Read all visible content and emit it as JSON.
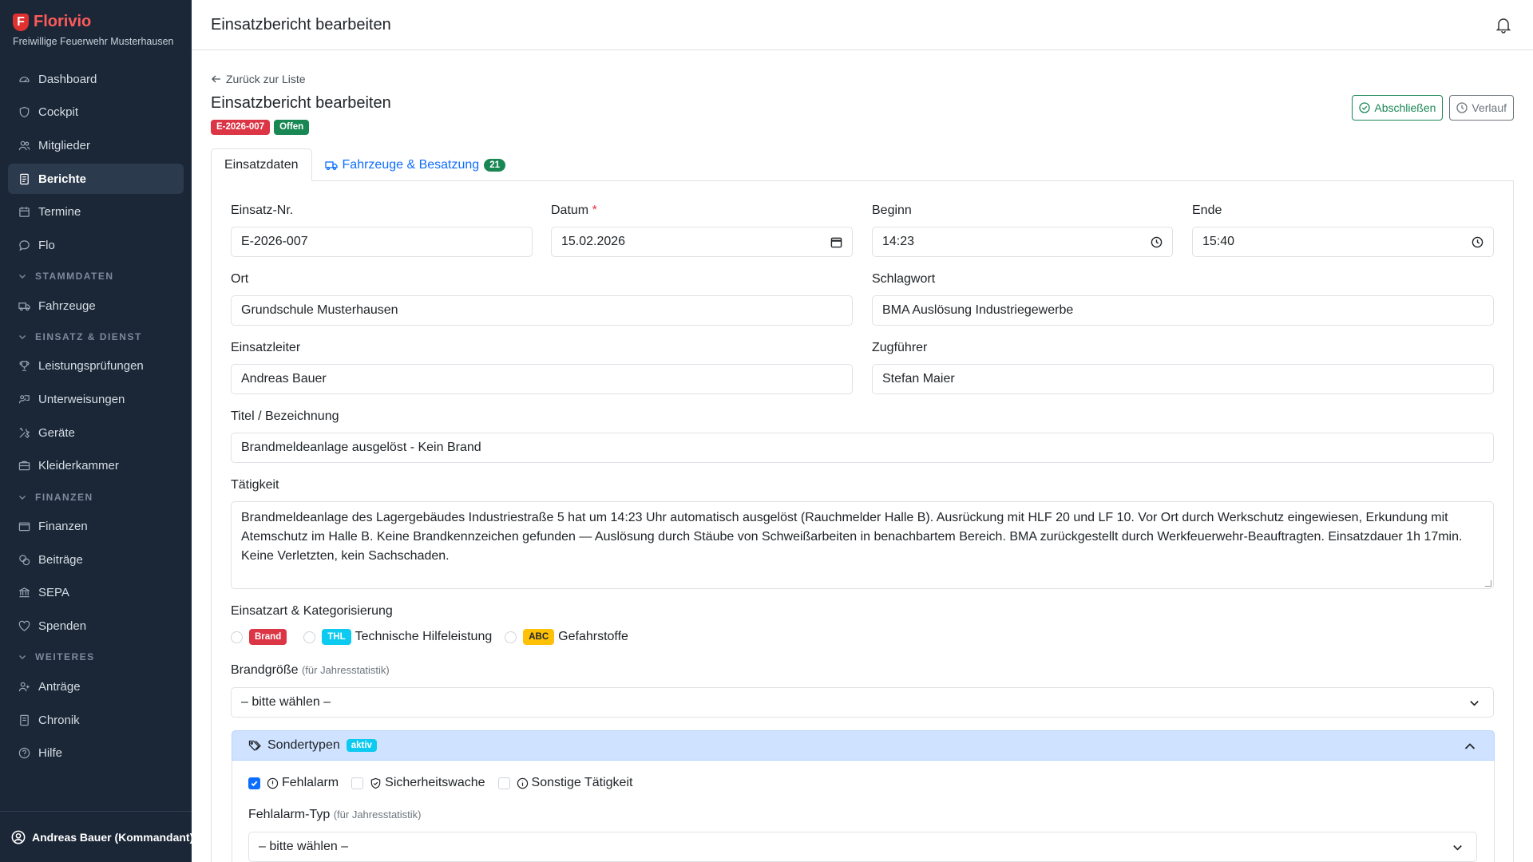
{
  "brand": {
    "name": "Florivio",
    "subtitle": "Freiwillige Feuerwehr Musterhausen",
    "logo_letter": "F"
  },
  "sidebar": {
    "items": [
      {
        "label": "Dashboard",
        "icon": "dashboard-icon"
      },
      {
        "label": "Cockpit",
        "icon": "shield-icon"
      },
      {
        "label": "Mitglieder",
        "icon": "users-icon"
      },
      {
        "label": "Berichte",
        "icon": "document-icon",
        "active": true
      },
      {
        "label": "Termine",
        "icon": "calendar-icon"
      },
      {
        "label": "Flo",
        "icon": "chat-icon"
      }
    ],
    "section_stammdaten": "STAMMDATEN",
    "stammdaten_items": [
      {
        "label": "Fahrzeuge",
        "icon": "truck-icon"
      }
    ],
    "section_einsatz": "EINSATZ & DIENST",
    "einsatz_items": [
      {
        "label": "Leistungsprüfungen",
        "icon": "trophy-icon"
      },
      {
        "label": "Unterweisungen",
        "icon": "presentation-icon"
      },
      {
        "label": "Geräte",
        "icon": "tools-icon"
      },
      {
        "label": "Kleiderkammer",
        "icon": "box-icon"
      }
    ],
    "section_finanzen": "FINANZEN",
    "finanzen_items": [
      {
        "label": "Finanzen",
        "icon": "wallet-icon"
      },
      {
        "label": "Beiträge",
        "icon": "coins-icon"
      },
      {
        "label": "SEPA",
        "icon": "bank-icon"
      },
      {
        "label": "Spenden",
        "icon": "heart-icon"
      }
    ],
    "section_weiteres": "WEITERES",
    "weiteres_items": [
      {
        "label": "Anträge",
        "icon": "user-plus-icon"
      },
      {
        "label": "Chronik",
        "icon": "book-icon"
      },
      {
        "label": "Hilfe",
        "icon": "help-icon"
      }
    ],
    "user": "Andreas Bauer (Kommandant)"
  },
  "header": {
    "title": "Einsatzbericht bearbeiten"
  },
  "main": {
    "back_link": "Zurück zur Liste",
    "title": "Einsatzbericht bearbeiten",
    "badge_id": "E-2026-007",
    "badge_status": "Offen",
    "btn_complete": "Abschließen",
    "btn_history": "Verlauf",
    "tab_data": "Einsatzdaten",
    "tab_vehicles": "Fahrzeuge & Besatzung",
    "tab_vehicles_count": "21"
  },
  "form": {
    "einsatz_nr": {
      "label": "Einsatz-Nr.",
      "value": "E-2026-007"
    },
    "datum": {
      "label": "Datum",
      "required_mark": "*",
      "value": "15.02.2026"
    },
    "beginn": {
      "label": "Beginn",
      "value": "14:23"
    },
    "ende": {
      "label": "Ende",
      "value": "15:40"
    },
    "ort": {
      "label": "Ort",
      "value": "Grundschule Musterhausen"
    },
    "schlagwort": {
      "label": "Schlagwort",
      "value": "BMA Auslösung Industriegewerbe"
    },
    "einsatzleiter": {
      "label": "Einsatzleiter",
      "value": "Andreas Bauer"
    },
    "zugfuehrer": {
      "label": "Zugführer",
      "value": "Stefan Maier"
    },
    "titel": {
      "label": "Titel / Bezeichnung",
      "value": "Brandmeldeanlage ausgelöst - Kein Brand"
    },
    "taetigkeit": {
      "label": "Tätigkeit",
      "value": "Brandmeldeanlage des Lagergebäudes Industriestraße 5 hat um 14:23 Uhr automatisch ausgelöst (Rauchmelder Halle B). Ausrückung mit HLF 20 und LF 10. Vor Ort durch Werkschutz eingewiesen, Erkundung mit Atemschutz im Halle B. Keine Brandkennzeichen gefunden — Auslösung durch Stäube von Schweißarbeiten in benachbartem Bereich. BMA zurückgestellt durch Werkfeuerwehr-Beauftragten. Einsatzdauer 1h 17min. Keine Verletzten, kein Sachschaden."
    },
    "einsatzart_label": "Einsatzart & Kategorisierung",
    "einsatzart": {
      "brand_badge": "Brand",
      "thl_badge": "THL",
      "thl_text": "Technische Hilfeleistung",
      "abc_badge": "ABC",
      "abc_text": "Gefahrstoffe"
    },
    "brandgroesse": {
      "label": "Brandgröße",
      "hint": "(für Jahresstatistik)",
      "value": "– bitte wählen –"
    },
    "sondertypen": {
      "title": "Sondertypen",
      "badge": "aktiv",
      "fehlalarm": "Fehlalarm",
      "fehlalarm_checked": true,
      "sicherheitswache": "Sicherheitswache",
      "sonstige": "Sonstige Tätigkeit"
    },
    "fehlalarm_typ": {
      "label": "Fehlalarm-Typ",
      "hint": "(für Jahresstatistik)",
      "value": "– bitte wählen –"
    }
  },
  "colors": {
    "sidebar_bg": "#1b2737",
    "brand_red": "#ff5a5a",
    "primary": "#0d6efd",
    "success": "#198754",
    "danger": "#dc3545",
    "info": "#0dcaf0",
    "warning": "#ffc107"
  }
}
